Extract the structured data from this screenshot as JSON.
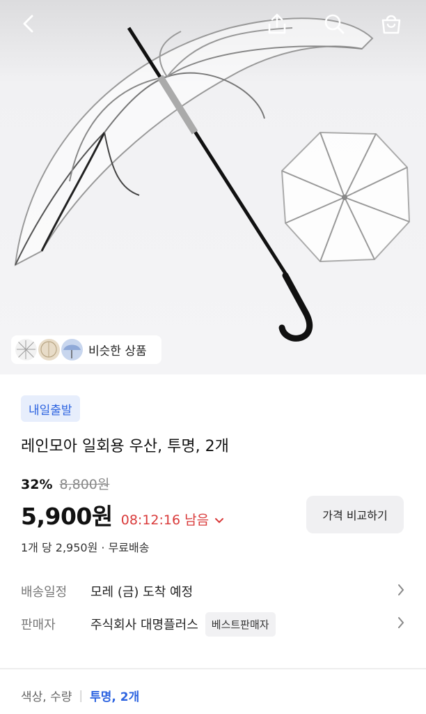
{
  "hero": {
    "image": "clear-umbrella-product-image",
    "similar_label": "비슷한 상품",
    "similar_thumbs": [
      "umbrella-thumb-1",
      "umbrella-thumb-2",
      "umbrella-thumb-3"
    ]
  },
  "topbar": {
    "back_icon": "back-arrow-icon",
    "share_icon": "share-icon",
    "search_icon": "search-icon",
    "cart_icon": "shopping-bag-icon"
  },
  "product": {
    "badge": "내일출발",
    "title": "레인모아 일회용 우산, 투명, 2개",
    "discount": "32%",
    "original_price": "8,800원",
    "price": "5,900원",
    "timer": "08:12:16 남음",
    "compare_label": "가격 비교하기",
    "unit_price": "1개 당 2,950원 · 무료배송"
  },
  "delivery": {
    "label": "배송일정",
    "value": "모레 (금) 도착 예정"
  },
  "seller": {
    "label": "판매자",
    "value": "주식회사 대명플러스",
    "badge": "베스트판매자"
  },
  "option": {
    "label": "색상, 수량",
    "separator": "|",
    "value": "투명, 2개"
  },
  "colors": {
    "accent_blue": "#2c63e0",
    "timer_red": "#d93a3a",
    "badge_bg": "#e7eefc"
  }
}
